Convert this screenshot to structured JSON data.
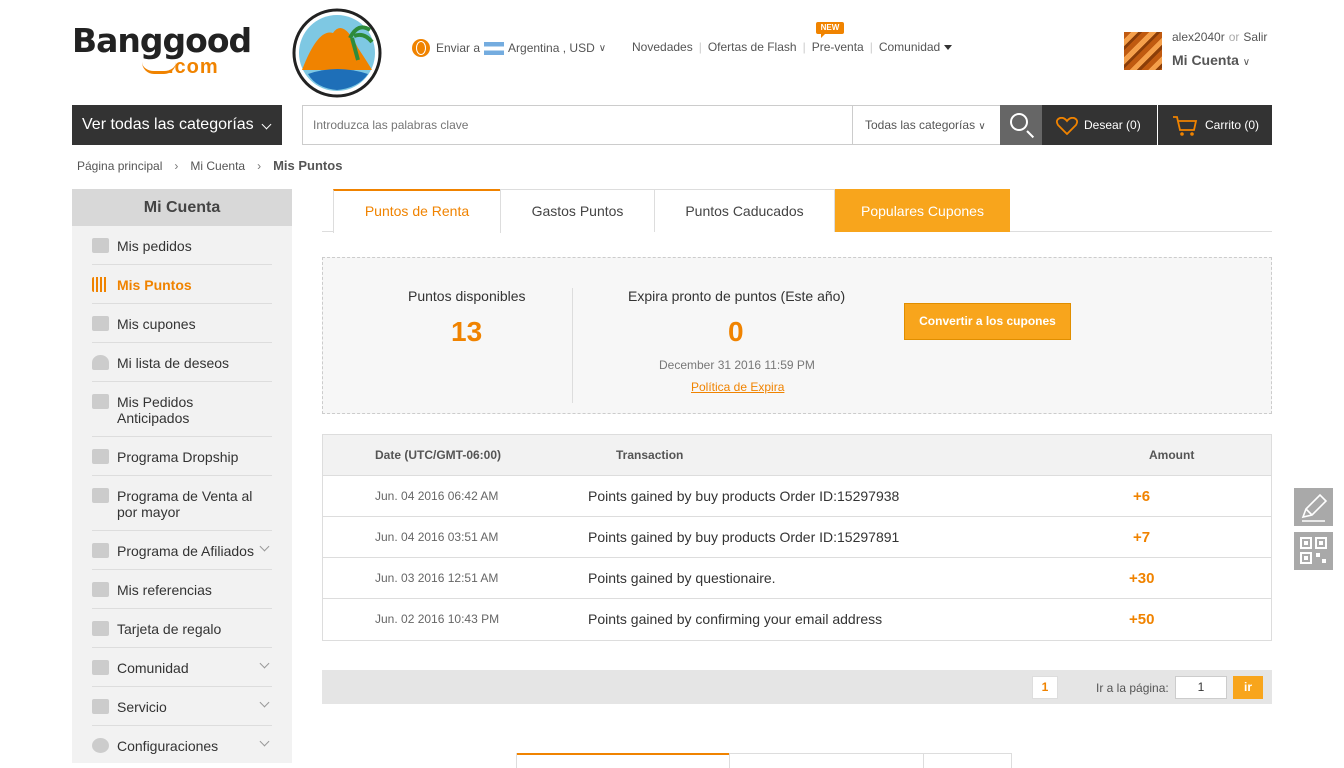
{
  "brand": {
    "name": "Banggood",
    "domain": ".com"
  },
  "header": {
    "ship_to_label": "Enviar a",
    "country": "Argentina",
    "currency": "USD",
    "nav": [
      {
        "label": "Novedades"
      },
      {
        "label": "Ofertas de Flash"
      },
      {
        "label": "Pre-venta",
        "badge": "NEW"
      },
      {
        "label": "Comunidad"
      }
    ],
    "user": {
      "name": "alex2040r",
      "or": "or",
      "logout": "Salir",
      "account_label": "Mi Cuenta"
    }
  },
  "search": {
    "categories_button": "Ver todas las categorías",
    "placeholder": "Introduzca las palabras clave",
    "scope": "Todas las categorías",
    "wishlist": "Desear (0)",
    "cart": "Carrito (0)"
  },
  "breadcrumb": [
    "Página principal",
    "Mi Cuenta",
    "Mis Puntos"
  ],
  "sidebar": {
    "title": "Mi Cuenta",
    "items": [
      {
        "label": "Mis pedidos",
        "icon": "clipboard-icon"
      },
      {
        "label": "Mis Puntos",
        "icon": "bars-icon",
        "active": true
      },
      {
        "label": "Mis cupones",
        "icon": "coupon-icon"
      },
      {
        "label": "Mi lista de deseos",
        "icon": "heart-icon"
      },
      {
        "label": "Mis Pedidos Anticipados",
        "icon": "document-icon"
      },
      {
        "label": "Programa Dropship",
        "icon": "truck-icon"
      },
      {
        "label": "Programa de Venta al por mayor",
        "icon": "box-icon"
      },
      {
        "label": "Programa de Afiliados",
        "icon": "people-icon",
        "expandable": true
      },
      {
        "label": "Mis referencias",
        "icon": "star-icon"
      },
      {
        "label": "Tarjeta de regalo",
        "icon": "gift-icon"
      },
      {
        "label": "Comunidad",
        "icon": "grid-icon",
        "expandable": true
      },
      {
        "label": "Servicio",
        "icon": "support-icon",
        "expandable": true
      },
      {
        "label": "Configuraciones",
        "icon": "gear-icon",
        "expandable": true
      }
    ]
  },
  "tabs": [
    {
      "label": "Puntos de Renta",
      "active": true
    },
    {
      "label": "Gastos Puntos"
    },
    {
      "label": "Puntos Caducados"
    },
    {
      "label": "Populares Cupones",
      "highlight": true
    }
  ],
  "summary": {
    "available_label": "Puntos disponibles",
    "available_value": "13",
    "expiring_label": "Expira pronto de puntos (Este año)",
    "expiring_value": "0",
    "expiring_date": "December 31 2016 11:59 PM",
    "policy_link": "Política de Expira",
    "convert_button": "Convertir a los cupones"
  },
  "table": {
    "headers": {
      "date": "Date (UTC/GMT-06:00)",
      "transaction": "Transaction",
      "amount": "Amount"
    },
    "rows": [
      {
        "date": "Jun. 04 2016 06:42 AM",
        "transaction": "Points gained by buy products Order ID:15297938",
        "amount": "+6"
      },
      {
        "date": "Jun. 04 2016 03:51 AM",
        "transaction": "Points gained by buy products Order ID:15297891",
        "amount": "+7"
      },
      {
        "date": "Jun. 03 2016 12:51 AM",
        "transaction": "Points gained by questionaire.",
        "amount": "+30"
      },
      {
        "date": "Jun. 02 2016 10:43 PM",
        "transaction": "Points gained by confirming your email address",
        "amount": "+50"
      }
    ]
  },
  "pagination": {
    "current_page": "1",
    "goto_label": "Ir a la página:",
    "goto_value": "1",
    "goto_button": "ir"
  },
  "colors": {
    "accent": "#f08300",
    "promo": "#f8a51c",
    "dark": "#333333"
  }
}
